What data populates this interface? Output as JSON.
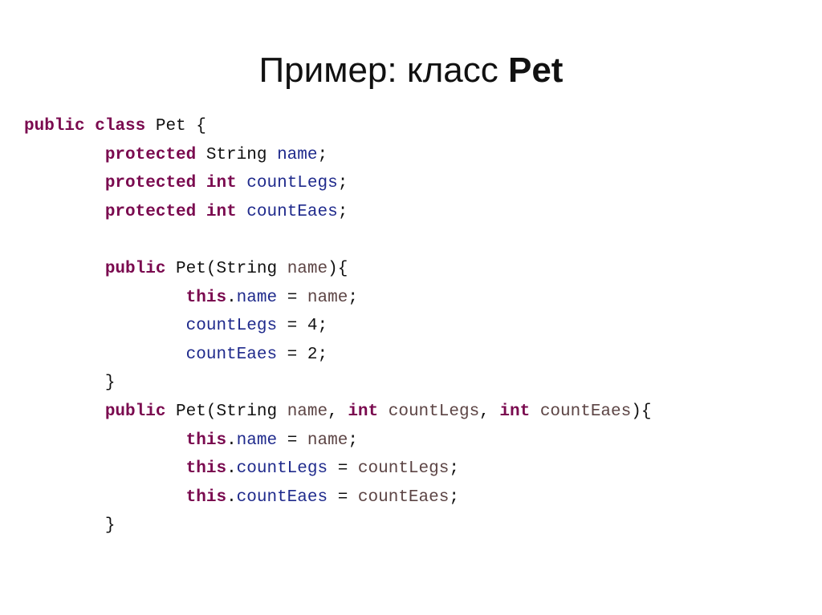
{
  "slide": {
    "title_prefix": "Пример: класс ",
    "title_bold": "Pet"
  },
  "colors": {
    "keyword": "#7a0a4f",
    "field": "#1f2a8c",
    "parameter": "#5c4444",
    "text": "#111111",
    "background": "#ffffff"
  },
  "code": {
    "lines": [
      [
        {
          "t": "kw",
          "v": "public"
        },
        {
          "t": "txt",
          "v": " "
        },
        {
          "t": "kw",
          "v": "class"
        },
        {
          "t": "txt",
          "v": " Pet {"
        }
      ],
      [
        {
          "t": "txt",
          "v": "        "
        },
        {
          "t": "kw",
          "v": "protected"
        },
        {
          "t": "txt",
          "v": " String "
        },
        {
          "t": "fld",
          "v": "name"
        },
        {
          "t": "txt",
          "v": ";"
        }
      ],
      [
        {
          "t": "txt",
          "v": "        "
        },
        {
          "t": "kw",
          "v": "protected"
        },
        {
          "t": "txt",
          "v": " "
        },
        {
          "t": "kw",
          "v": "int"
        },
        {
          "t": "txt",
          "v": " "
        },
        {
          "t": "fld",
          "v": "countLegs"
        },
        {
          "t": "txt",
          "v": ";"
        }
      ],
      [
        {
          "t": "txt",
          "v": "        "
        },
        {
          "t": "kw",
          "v": "protected"
        },
        {
          "t": "txt",
          "v": " "
        },
        {
          "t": "kw",
          "v": "int"
        },
        {
          "t": "txt",
          "v": " "
        },
        {
          "t": "fld",
          "v": "countEaes"
        },
        {
          "t": "txt",
          "v": ";"
        }
      ],
      [
        {
          "t": "txt",
          "v": ""
        }
      ],
      [
        {
          "t": "txt",
          "v": "        "
        },
        {
          "t": "kw",
          "v": "public"
        },
        {
          "t": "txt",
          "v": " Pet(String "
        },
        {
          "t": "prm",
          "v": "name"
        },
        {
          "t": "txt",
          "v": "){"
        }
      ],
      [
        {
          "t": "txt",
          "v": "                "
        },
        {
          "t": "kw",
          "v": "this"
        },
        {
          "t": "txt",
          "v": "."
        },
        {
          "t": "fld",
          "v": "name"
        },
        {
          "t": "txt",
          "v": " = "
        },
        {
          "t": "prm",
          "v": "name"
        },
        {
          "t": "txt",
          "v": ";"
        }
      ],
      [
        {
          "t": "txt",
          "v": "                "
        },
        {
          "t": "fld",
          "v": "countLegs"
        },
        {
          "t": "txt",
          "v": " = 4;"
        }
      ],
      [
        {
          "t": "txt",
          "v": "                "
        },
        {
          "t": "fld",
          "v": "countEaes"
        },
        {
          "t": "txt",
          "v": " = 2;"
        }
      ],
      [
        {
          "t": "txt",
          "v": "        }"
        }
      ],
      [
        {
          "t": "txt",
          "v": "        "
        },
        {
          "t": "kw",
          "v": "public"
        },
        {
          "t": "txt",
          "v": " Pet(String "
        },
        {
          "t": "prm",
          "v": "name"
        },
        {
          "t": "txt",
          "v": ", "
        },
        {
          "t": "kw",
          "v": "int"
        },
        {
          "t": "txt",
          "v": " "
        },
        {
          "t": "prm",
          "v": "countLegs"
        },
        {
          "t": "txt",
          "v": ", "
        },
        {
          "t": "kw",
          "v": "int"
        },
        {
          "t": "txt",
          "v": " "
        },
        {
          "t": "prm",
          "v": "countEaes"
        },
        {
          "t": "txt",
          "v": "){"
        }
      ],
      [
        {
          "t": "txt",
          "v": "                "
        },
        {
          "t": "kw",
          "v": "this"
        },
        {
          "t": "txt",
          "v": "."
        },
        {
          "t": "fld",
          "v": "name"
        },
        {
          "t": "txt",
          "v": " = "
        },
        {
          "t": "prm",
          "v": "name"
        },
        {
          "t": "txt",
          "v": ";"
        }
      ],
      [
        {
          "t": "txt",
          "v": "                "
        },
        {
          "t": "kw",
          "v": "this"
        },
        {
          "t": "txt",
          "v": "."
        },
        {
          "t": "fld",
          "v": "countLegs"
        },
        {
          "t": "txt",
          "v": " = "
        },
        {
          "t": "prm",
          "v": "countLegs"
        },
        {
          "t": "txt",
          "v": ";"
        }
      ],
      [
        {
          "t": "txt",
          "v": "                "
        },
        {
          "t": "kw",
          "v": "this"
        },
        {
          "t": "txt",
          "v": "."
        },
        {
          "t": "fld",
          "v": "countEaes"
        },
        {
          "t": "txt",
          "v": " = "
        },
        {
          "t": "prm",
          "v": "countEaes"
        },
        {
          "t": "txt",
          "v": ";"
        }
      ],
      [
        {
          "t": "txt",
          "v": "        }"
        }
      ]
    ]
  }
}
